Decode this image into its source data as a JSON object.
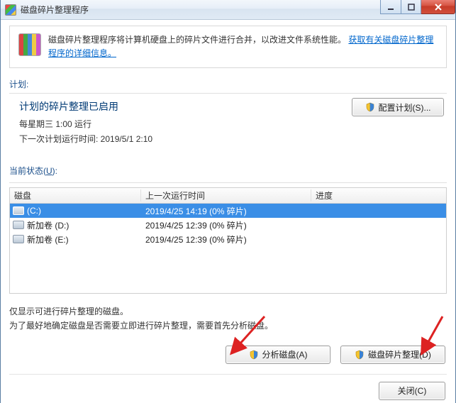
{
  "window": {
    "title": "磁盘碎片整理程序"
  },
  "info": {
    "text_before_link": "磁盘碎片整理程序将计算机硬盘上的碎片文件进行合并，以改进文件系统性能。",
    "link": "获取有关磁盘碎片整理程序的详细信息。"
  },
  "schedule": {
    "section_label": "计划:",
    "heading": "计划的碎片整理已启用",
    "recurrence": "每星期三  1:00 运行",
    "next_run": "下一次计划运行时间: 2019/5/1 2:10",
    "config_button": "配置计划(S)..."
  },
  "status": {
    "section_label_prefix": "当前状态(",
    "section_label_u": "U",
    "section_label_suffix": "):",
    "columns": {
      "disk": "磁盘",
      "last_run": "上一次运行时间",
      "progress": "进度"
    },
    "rows": [
      {
        "name": "(C:)",
        "last": "2019/4/25 14:19 (0% 碎片)",
        "progress": "",
        "selected": true
      },
      {
        "name": "新加卷 (D:)",
        "last": "2019/4/25 12:39 (0% 碎片)",
        "progress": "",
        "selected": false
      },
      {
        "name": "新加卷 (E:)",
        "last": "2019/4/25 12:39 (0% 碎片)",
        "progress": "",
        "selected": false
      }
    ]
  },
  "hints": {
    "line1": "仅显示可进行碎片整理的磁盘。",
    "line2": "为了最好地确定磁盘是否需要立即进行碎片整理，需要首先分析磁盘。"
  },
  "buttons": {
    "analyze": "分析磁盘(A)",
    "defrag": "磁盘碎片整理(D)",
    "close": "关闭(C)"
  }
}
